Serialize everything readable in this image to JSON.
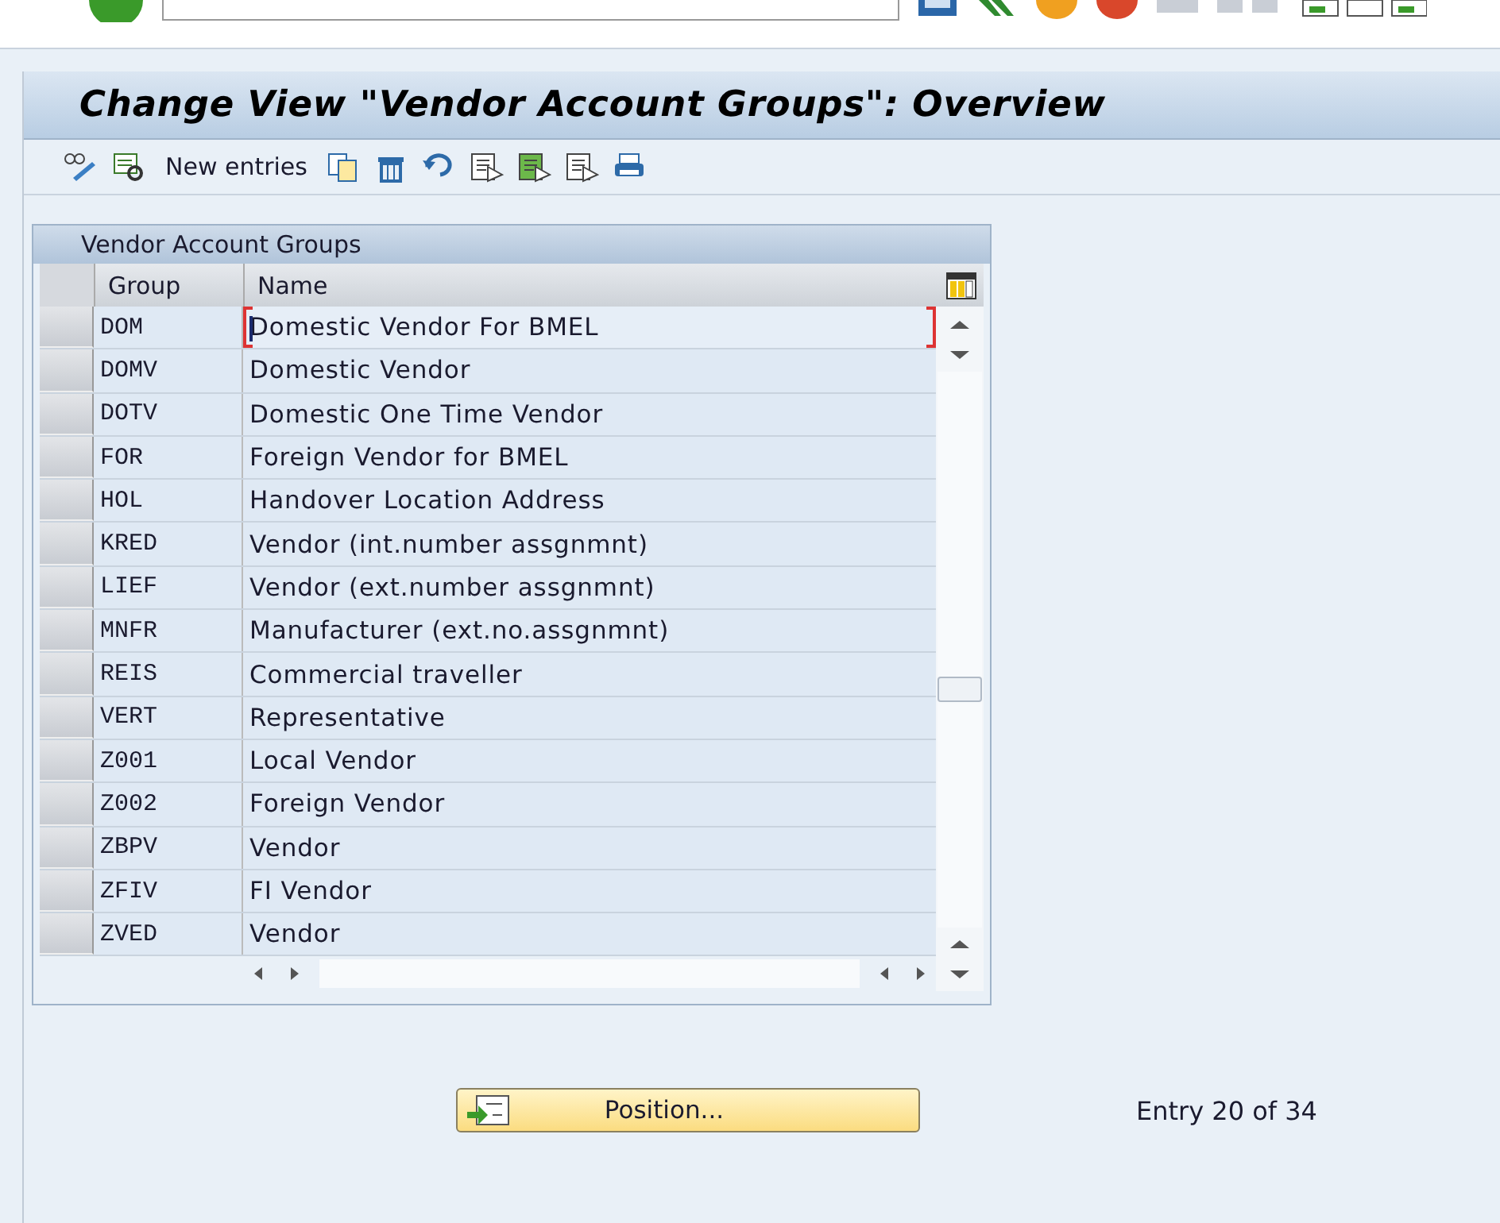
{
  "window": {
    "title": "Change View \"Vendor Account Groups\": Overview"
  },
  "toolbar": {
    "items": [
      {
        "kind": "icon"
      },
      {
        "kind": "icon"
      },
      {
        "kind": "text",
        "label": "New entries"
      },
      {
        "kind": "icon"
      },
      {
        "kind": "icon"
      },
      {
        "kind": "icon"
      },
      {
        "kind": "icon"
      },
      {
        "kind": "icon"
      },
      {
        "kind": "icon"
      },
      {
        "kind": "icon"
      }
    ]
  },
  "table": {
    "title": "Vendor Account Groups",
    "columns": [
      "Group",
      "Name"
    ],
    "rows": [
      {
        "group": "DOM",
        "name": "Domestic Vendor For BMEL",
        "focused": true
      },
      {
        "group": "DOMV",
        "name": "Domestic Vendor",
        "focused": false
      },
      {
        "group": "DOTV",
        "name": "Domestic One Time Vendor",
        "focused": false
      },
      {
        "group": "FOR",
        "name": "Foreign Vendor for BMEL",
        "focused": false
      },
      {
        "group": "HOL",
        "name": "Handover Location Address",
        "focused": false
      },
      {
        "group": "KRED",
        "name": "Vendor (int.number assgnmnt)",
        "focused": false
      },
      {
        "group": "LIEF",
        "name": "Vendor (ext.number assgnmnt)",
        "focused": false
      },
      {
        "group": "MNFR",
        "name": "Manufacturer (ext.no.assgnmnt)",
        "focused": false
      },
      {
        "group": "REIS",
        "name": "Commercial traveller",
        "focused": false
      },
      {
        "group": "VERT",
        "name": "Representative",
        "focused": false
      },
      {
        "group": "Z001",
        "name": "Local Vendor",
        "focused": false
      },
      {
        "group": "Z002",
        "name": "Foreign Vendor",
        "focused": false
      },
      {
        "group": "ZBPV",
        "name": "Vendor",
        "focused": false
      },
      {
        "group": "ZFIV",
        "name": "FI Vendor",
        "focused": false
      },
      {
        "group": "ZVED",
        "name": "Vendor",
        "focused": false
      }
    ]
  },
  "position_button": {
    "label": "Position..."
  },
  "entry_info": "Entry 20 of 34"
}
